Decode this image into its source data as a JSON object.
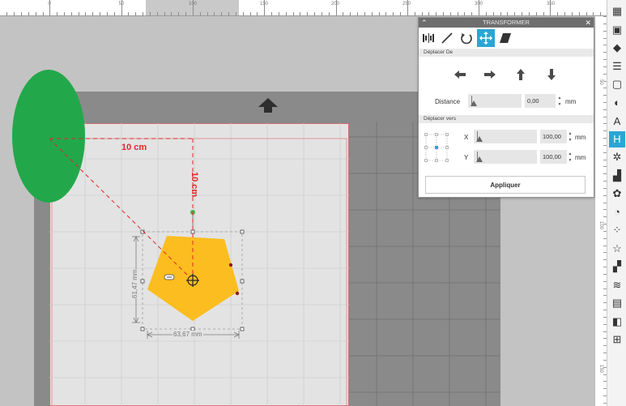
{
  "ruler": {
    "top_numbers": [
      "0",
      "50",
      "100",
      "150",
      "200",
      "250",
      "300",
      "350"
    ],
    "right_numbers": [
      "50",
      "100",
      "150"
    ]
  },
  "canvas": {
    "dim_horizontal": "10 cm",
    "dim_vertical": "10 cm",
    "shape_height_label": "61,47 mm",
    "shape_width_label": "63,67 mm",
    "colors": {
      "ellipse": "#22a84a",
      "pentagon": "#fbbd1f",
      "dim_lines": "#e0262a",
      "page_bg": "#e3e3e3"
    }
  },
  "transformer": {
    "title": "TRANSFORMER",
    "tabs": [
      "align-icon",
      "scale-icon",
      "rotate-icon",
      "move-icon",
      "shear-icon"
    ],
    "active_tab": "move-icon",
    "section_move_by": "Déplacer De",
    "arrows": [
      "arrow-left-icon",
      "arrow-right-icon",
      "arrow-up-icon",
      "arrow-down-icon"
    ],
    "distance_label": "Distance",
    "distance_value": "0,00",
    "distance_unit": "mm",
    "section_move_to": "Déplacer vers",
    "x_label": "X",
    "x_value": "100,00",
    "x_unit": "mm",
    "y_label": "Y",
    "y_value": "100,00",
    "y_unit": "mm",
    "apply_label": "Appliquer",
    "accent_color": "#2aa6d6"
  },
  "sidebar": {
    "items": [
      "page-setup-icon",
      "library-icon",
      "store-icon",
      "lines-icon",
      "image-icon",
      "fill-icon",
      "text-icon",
      "transform-icon",
      "replicate-icon",
      "modify-icon",
      "offset-icon",
      "trace-icon",
      "print-cut-icon",
      "shapes-icon",
      "send-icon",
      "layers-icon",
      "edit-points-icon",
      "library2-icon",
      "misc-icon"
    ],
    "icon_glyphs": [
      "▦",
      "▣",
      "◆",
      "☰",
      "▢",
      "◐",
      "A",
      "H",
      "✲",
      "▟",
      "✿",
      "◔",
      "⁘",
      "☆",
      "▞",
      "≋",
      "▤",
      "◧",
      "⊞"
    ],
    "active_index": 7
  }
}
